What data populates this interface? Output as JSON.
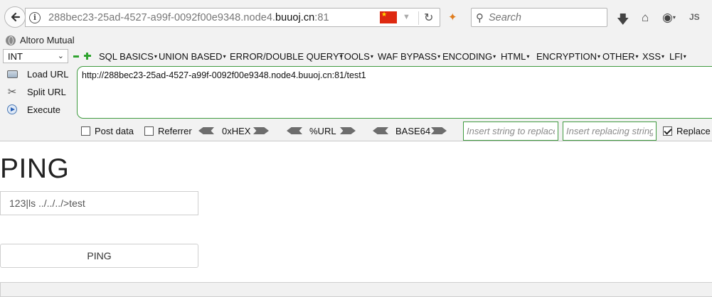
{
  "browser": {
    "url_prefix": "288bec23-25ad-4527-a99f-0092f00e9348.node4.",
    "url_domain": "buuoj.cn",
    "url_port": ":81",
    "search_placeholder": "Search",
    "js_badge": "JS"
  },
  "bookmarks": [
    {
      "label": "Altoro Mutual",
      "icon": "globe-icon"
    }
  ],
  "hackbar": {
    "type_select": "INT",
    "menu": [
      "SQL BASICS",
      "UNION BASED",
      "ERROR/DOUBLE QUERY",
      "TOOLS",
      "WAF BYPASS",
      "ENCODING",
      "HTML",
      "ENCRYPTION",
      "OTHER",
      "XSS",
      "LFI"
    ],
    "actions": {
      "load": "Load URL",
      "split": "Split URL",
      "execute": "Execute"
    },
    "url_value": "http://288bec23-25ad-4527-a99f-0092f00e9348.node4.buuoj.cn:81/test1",
    "options": {
      "post_data": "Post data",
      "referrer": "Referrer",
      "hex": "0xHEX",
      "url_enc": "%URL",
      "base64": "BASE64",
      "insert_placeholder": "Insert string to replace",
      "replacing_placeholder": "Insert replacing string",
      "replace_all": "Replace All",
      "post_checked": false,
      "referrer_checked": false,
      "replace_checked": true
    }
  },
  "page": {
    "title": "PING",
    "input_value": "123|ls ../../../>test",
    "button_label": "PING"
  },
  "colors": {
    "hackbar_green": "#3f9a3f",
    "flag_red": "#de2910",
    "flag_star": "#ffde00"
  }
}
